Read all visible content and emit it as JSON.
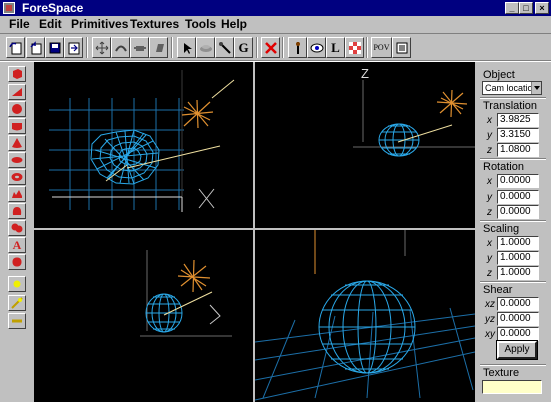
{
  "window": {
    "title": "ForeSpace"
  },
  "menu": {
    "items": [
      "File",
      "Edit",
      "Primitives",
      "Textures",
      "Tools",
      "Help"
    ]
  },
  "toolbar": {
    "g_label": "G",
    "l_label": "L",
    "pov_label": "POV"
  },
  "palette": {
    "text_tool_label": "A"
  },
  "viewports": {
    "z_axis_label": "Z"
  },
  "panel": {
    "object_label": "Object",
    "object_value": "Cam location",
    "translation_label": "Translation",
    "translation": {
      "x": "3.9825",
      "y": "3.3150",
      "z": "1.0800"
    },
    "rotation_label": "Rotation",
    "rotation": {
      "x": "0.0000",
      "y": "0.0000",
      "z": "0.0000"
    },
    "scaling_label": "Scaling",
    "scaling": {
      "x": "1.0000",
      "y": "1.0000",
      "z": "1.0000"
    },
    "shear_label": "Shear",
    "shear": {
      "xz": "0.0000",
      "yz": "0.0000",
      "xy": "0.0000"
    },
    "axis_x": "x",
    "axis_y": "y",
    "axis_z": "z",
    "axis_xz": "xz",
    "axis_yz": "yz",
    "axis_xy": "xy",
    "apply_label": "Apply",
    "texture_label": "Texture",
    "texture_value": ""
  },
  "colors": {
    "titlebar": "#000080",
    "wire_blue": "#2aa8e8",
    "light_orange": "#e09030",
    "camera_beige": "#f0e0a0",
    "grid_blue": "#1c6fa8"
  }
}
